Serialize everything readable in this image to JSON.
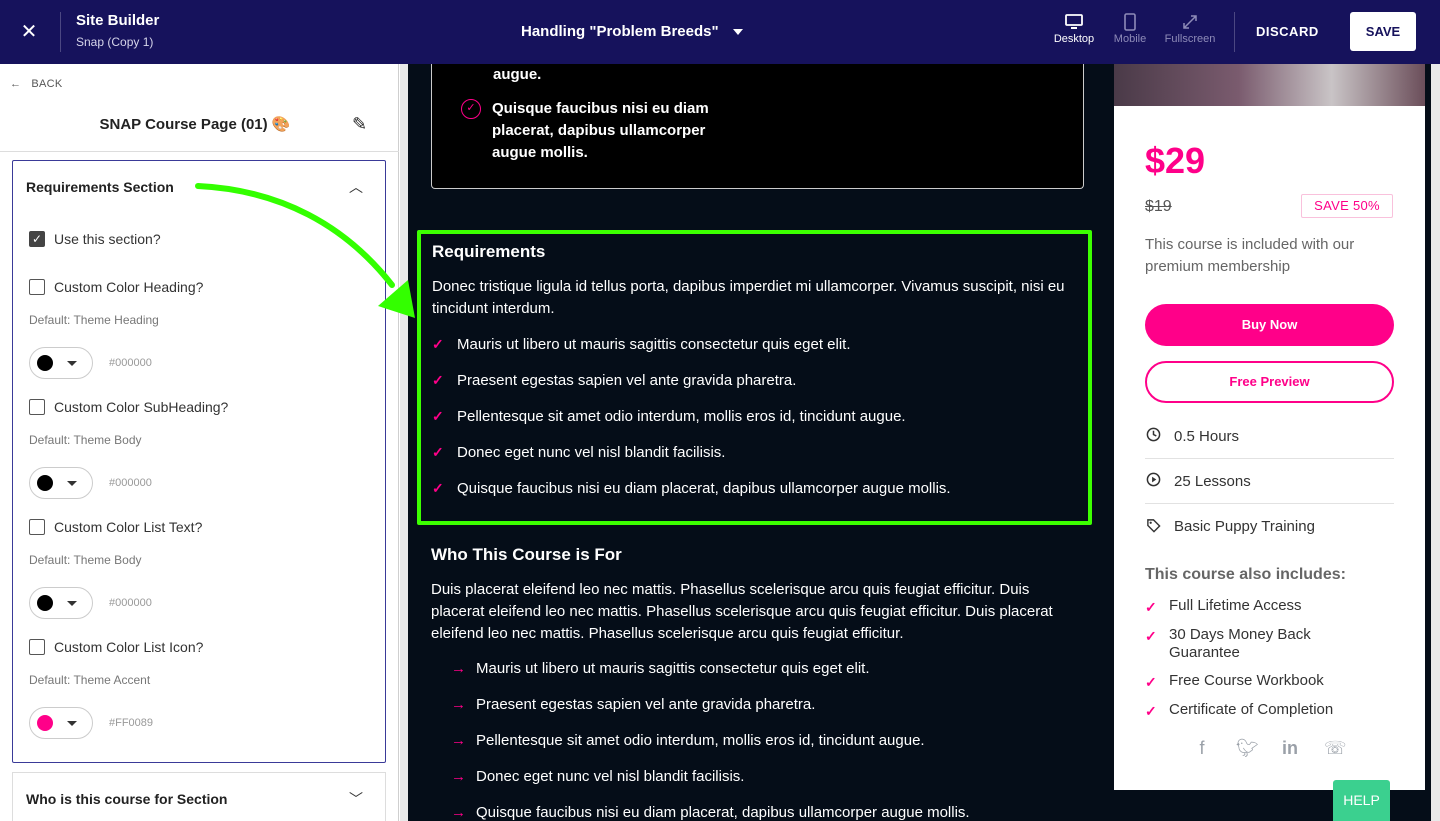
{
  "topbar": {
    "app_title": "Site Builder",
    "app_subtitle": "Snap (Copy 1)",
    "page_select": "Handling \"Problem Breeds\"",
    "views": [
      {
        "label": "Desktop",
        "icon": "desktop-icon"
      },
      {
        "label": "Mobile",
        "icon": "mobile-icon"
      },
      {
        "label": "Fullscreen",
        "icon": "fullscreen-icon"
      }
    ],
    "discard": "DISCARD",
    "save": "SAVE",
    "colors": {
      "bar": "#16125c"
    }
  },
  "sidebar": {
    "back": "BACK",
    "title": "SNAP Course Page (01) 🎨",
    "panel_title": "Requirements Section",
    "use_section": "Use this section?",
    "options": [
      {
        "label": "Custom Color Heading?",
        "default": "Default: Theme Heading",
        "hex": "#000000",
        "swatch": "#000000"
      },
      {
        "label": "Custom Color SubHeading?",
        "default": "Default: Theme Body",
        "hex": "#000000",
        "swatch": "#000000"
      },
      {
        "label": "Custom Color List Text?",
        "default": "Default: Theme Body",
        "hex": "#000000",
        "swatch": "#000000"
      },
      {
        "label": "Custom Color List Icon?",
        "default": "Default: Theme Accent",
        "hex": "#FF0089",
        "swatch": "#ff0089"
      }
    ],
    "next_panel_title": "Who is this course for Section"
  },
  "canvas": {
    "top_card": {
      "partial_text": "augue.",
      "item": "Quisque faucibus nisi eu diam placerat, dapibus ullamcorper augue mollis."
    },
    "requirements": {
      "title": "Requirements",
      "body": "Donec tristique ligula id tellus porta, dapibus imperdiet mi ullamcorper. Vivamus suscipit, nisi eu tincidunt interdum.",
      "items": [
        "Mauris ut libero ut mauris sagittis consectetur quis eget elit.",
        "Praesent egestas sapien vel ante gravida pharetra.",
        "Pellentesque sit amet odio interdum, mollis eros id, tincidunt augue.",
        "Donec eget nunc vel nisl blandit facilisis.",
        "Quisque faucibus nisi eu diam placerat, dapibus ullamcorper augue mollis."
      ]
    },
    "who": {
      "title": "Who This Course is For",
      "body": "Duis placerat eleifend leo nec mattis. Phasellus scelerisque arcu quis feugiat efficitur. Duis placerat eleifend leo nec mattis. Phasellus scelerisque arcu quis feugiat efficitur. Duis placerat eleifend leo nec mattis. Phasellus scelerisque arcu quis feugiat efficitur.",
      "items": [
        "Mauris ut libero ut mauris sagittis consectetur quis eget elit.",
        "Praesent egestas sapien vel ante gravida pharetra.",
        "Pellentesque sit amet odio interdum, mollis eros id, tincidunt augue.",
        "Donec eget nunc vel nisl blandit facilisis.",
        "Quisque faucibus nisi eu diam placerat, dapibus ullamcorper augue mollis."
      ]
    },
    "pricing": {
      "price": "$29",
      "old_price": "$19",
      "save_badge": "SAVE 50%",
      "included": "This course is included with our premium membership",
      "buy": "Buy Now",
      "preview": "Free Preview",
      "meta": [
        {
          "icon": "clock-icon",
          "text": "0.5 Hours"
        },
        {
          "icon": "play-icon",
          "text": "25 Lessons"
        },
        {
          "icon": "tag-icon",
          "text": "Basic Puppy Training"
        }
      ],
      "also_title": "This course also includes:",
      "also_items": [
        "Full Lifetime Access",
        "30 Days Money Back Guarantee",
        "Free Course Workbook",
        "Certificate of Completion"
      ],
      "socials": [
        "facebook-icon",
        "twitter-icon",
        "linkedin-icon",
        "whatsapp-icon"
      ]
    },
    "colors": {
      "accent": "#ff0089",
      "highlight": "#3cff00",
      "page_bg": "#050d18"
    }
  },
  "help": "HELP"
}
